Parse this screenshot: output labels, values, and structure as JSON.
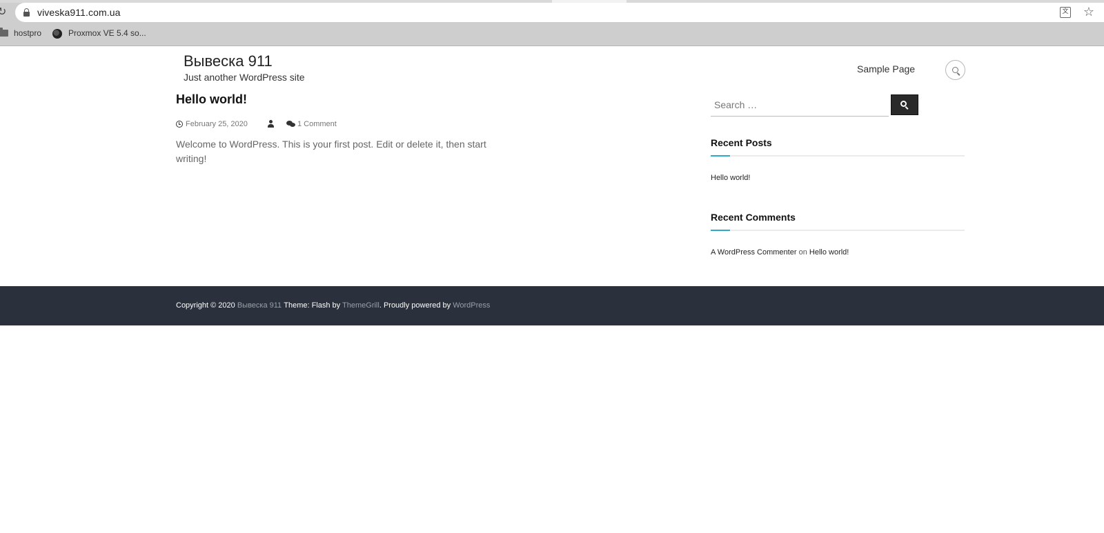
{
  "browser": {
    "url": "viveska911.com.ua",
    "bookmarks": [
      {
        "label": "hostpro"
      },
      {
        "label": "Proxmox VE 5.4 so..."
      }
    ]
  },
  "site": {
    "title": "Вывеска 911",
    "tagline": "Just another WordPress site",
    "nav": {
      "sample_page": "Sample Page"
    }
  },
  "post": {
    "title": "Hello world!",
    "date": "February 25, 2020",
    "comments": "1 Comment",
    "excerpt": "Welcome to WordPress. This is your first post. Edit or delete it, then start writing!"
  },
  "sidebar": {
    "search_placeholder": "Search …",
    "recent_posts_title": "Recent Posts",
    "recent_posts": [
      "Hello world!"
    ],
    "recent_comments_title": "Recent Comments",
    "recent_comment": {
      "author": "A WordPress Commenter",
      "on": "on",
      "post": "Hello world!"
    }
  },
  "footer": {
    "prefix": "Copyright © 2020 ",
    "site_link": "Вывеска 911",
    "theme_text": " Theme: Flash by ",
    "themegrill": "ThemeGrill",
    "powered": ". Proudly powered by ",
    "wordpress": "WordPress"
  },
  "colors": {
    "accent": "#30a8c7",
    "footer_bg": "#2a313c",
    "button_bg": "#2a2a2a"
  }
}
